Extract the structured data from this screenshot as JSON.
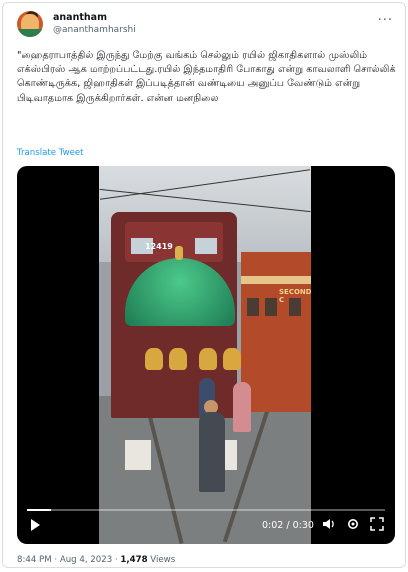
{
  "tweet": {
    "name": "anantham",
    "handle": "@ananthamharshi",
    "text": "\"ஹைதராபாத்தில் இருந்து மேற்கு வங்கம் செல்லும் ரயில் ஜிகாதிகளால் முஸ்லிம் எக்ஸ்பிரஸ் ஆக மாற்றப்பட்டது.ரயில் இந்தமாதிரி போகாது என்று காவலாளி சொல்லிக் கொண்டிருக்க, ஜிஹாதிகள் இப்படித்தான் வண்டியை அனுப்ப வேண்டும் என்று பிடிவாதமாக இருக்கிறார்கள். என்ன மனநிலை",
    "translate_label": "Translate Tweet",
    "more_label": "···"
  },
  "video": {
    "locomotive_number": "12419",
    "coach_label": "SECOND C",
    "time_display": "0:02 / 0:30",
    "progress_fraction": 0.066
  },
  "footer": {
    "time": "8:44 PM",
    "separator": "·",
    "date": "Aug 4, 2023",
    "views_count": "1,478",
    "views_label": "Views"
  },
  "colors": {
    "link": "#1d9bf0",
    "secondary_text": "#536471"
  },
  "icons": {
    "play": "play-icon",
    "volume": "volume-icon",
    "settings": "gear-icon",
    "fullscreen": "fullscreen-icon",
    "more": "more-icon"
  }
}
